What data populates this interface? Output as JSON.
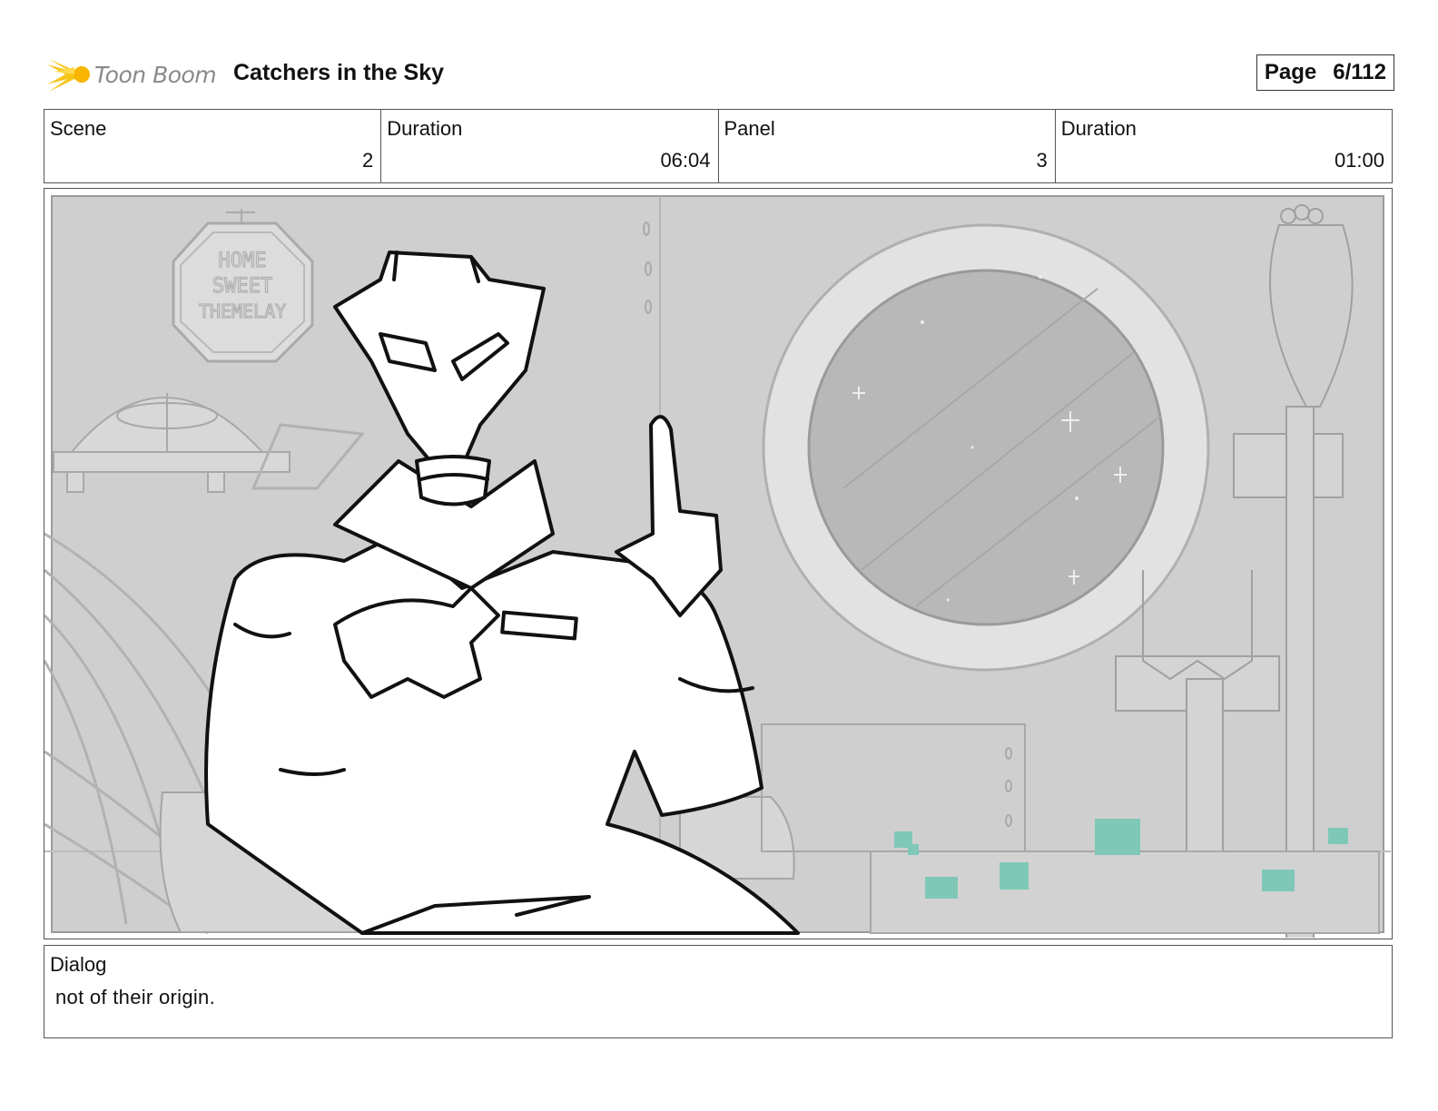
{
  "header": {
    "logo_text": "Toon Boom",
    "project_title": "Catchers in the Sky",
    "page_label": "Page",
    "page_number": "6/112"
  },
  "info": {
    "scene_label": "Scene",
    "scene_value": "2",
    "scene_duration_label": "Duration",
    "scene_duration_value": "06:04",
    "panel_label": "Panel",
    "panel_value": "3",
    "panel_duration_label": "Duration",
    "panel_duration_value": "01:00"
  },
  "panel_image": {
    "sign_text": [
      "HOME",
      "SWEET",
      "THEMELAY"
    ],
    "colors": {
      "background": "#cfcfcf",
      "accent": "#7fc8b8",
      "lines": "#111111"
    }
  },
  "dialog": {
    "label": "Dialog",
    "text": "not of their origin."
  }
}
